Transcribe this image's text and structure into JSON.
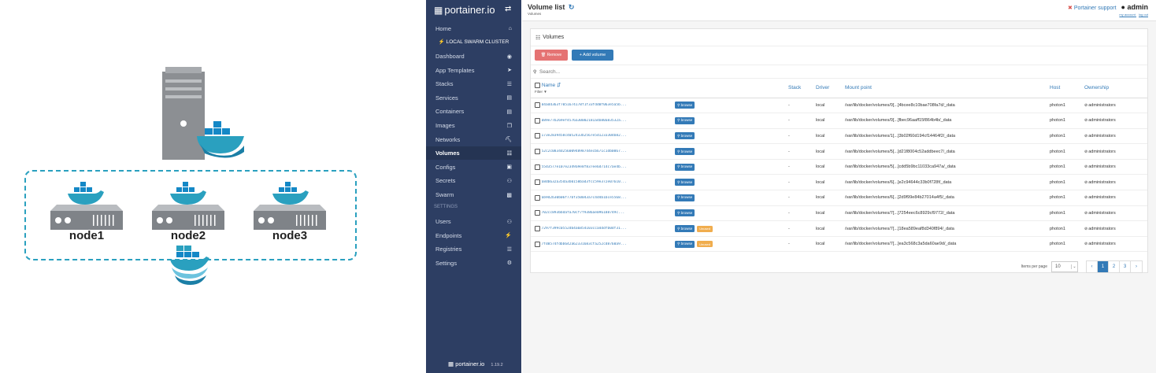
{
  "diagram": {
    "nodes": [
      "node1",
      "node2",
      "node3"
    ]
  },
  "sidebar": {
    "brand": "portainer.io",
    "cluster": "LOCAL SWARM CLUSTER",
    "home": "Home",
    "items": [
      {
        "label": "Dashboard",
        "icon": "tachometer-icon"
      },
      {
        "label": "App Templates",
        "icon": "rocket-icon"
      },
      {
        "label": "Stacks",
        "icon": "th-list-icon"
      },
      {
        "label": "Services",
        "icon": "list-alt-icon"
      },
      {
        "label": "Containers",
        "icon": "server-icon"
      },
      {
        "label": "Images",
        "icon": "clone-icon"
      },
      {
        "label": "Networks",
        "icon": "sitemap-icon"
      },
      {
        "label": "Volumes",
        "icon": "cubes-icon"
      },
      {
        "label": "Configs",
        "icon": "file-code-icon"
      },
      {
        "label": "Secrets",
        "icon": "user-secret-icon"
      },
      {
        "label": "Swarm",
        "icon": "object-group-icon"
      }
    ],
    "settings_header": "SETTINGS",
    "settings_items": [
      {
        "label": "Users",
        "icon": "users-icon"
      },
      {
        "label": "Endpoints",
        "icon": "plug-icon"
      },
      {
        "label": "Registries",
        "icon": "database-icon"
      },
      {
        "label": "Settings",
        "icon": "cogs-icon"
      }
    ],
    "footer_brand": "portainer.io",
    "footer_version": "1.19.2"
  },
  "header": {
    "title": "Volume list",
    "breadcrumb": "Volumes",
    "support": "Portainer support",
    "user": "admin",
    "my_account": "my account",
    "log_out": "log out"
  },
  "panel": {
    "title": "Volumes",
    "remove_label": "Remove",
    "add_label": "+ Add volume",
    "search_placeholder": "Search...",
    "columns": {
      "name": "Name",
      "filter": "Filter",
      "stack": "Stack",
      "driver": "Driver",
      "mount": "Mount point",
      "host": "Host",
      "ownership": "Ownership"
    },
    "browse_label": "browse",
    "unused_label": "Unused",
    "rows": [
      {
        "name": "04add363f7051674178f1f33fdd0f063e5a5b...",
        "stack": "-",
        "driver": "local",
        "mount": "/var/lib/docker/volumes/0[...]4bcee8c10bae708fa7d/_data",
        "host": "photon1",
        "owner": "administrators",
        "unused": false
      },
      {
        "name": "089e77b269ef4576a30002181a4b80a83532a...",
        "stack": "-",
        "driver": "local",
        "mount": "/var/lib/docker/volumes/0[...]fbec96aaff15f864b4b/_data",
        "host": "photon1",
        "owner": "administrators",
        "unused": false
      },
      {
        "name": "173e2839458c4052433b2567e5d1233304b82...",
        "stack": "-",
        "driver": "local",
        "mount": "/var/lib/docker/volumes/1[...]3b02f60d194cf14464f2/_data",
        "host": "photon1",
        "owner": "administrators",
        "unused": false
      },
      {
        "name": "52c2c0834d2560094898744ecb671c1db0067...",
        "stack": "-",
        "driver": "local",
        "mount": "/var/lib/docker/volumes/5[...]d21f8004c52addbeec7/_data",
        "host": "photon1",
        "owner": "administrators",
        "unused": false
      },
      {
        "name": "55d3577e107e2349a9e8f837ee6d714c7ae4b...",
        "stack": "-",
        "driver": "local",
        "mount": "/var/lib/docker/volumes/5[...]cdd5b9bc11033ca947a/_data",
        "host": "photon1",
        "owner": "administrators",
        "unused": false
      },
      {
        "name": "68db632a35da3b0158bad3fcc59e372e07610...",
        "stack": "-",
        "driver": "local",
        "mount": "/var/lib/docker/volumes/6[...]e2c94644c33b0f728f/_data",
        "host": "photon1",
        "owner": "administrators",
        "unused": false
      },
      {
        "name": "6b9d2b30b06f77bf350043a7c4d4b1bce5568...",
        "stack": "-",
        "driver": "local",
        "mount": "/var/lib/docker/volumes/6[...]2d9f99e84b27014a4f5/_data",
        "host": "photon1",
        "owner": "administrators",
        "unused": false
      },
      {
        "name": "702cc893bbdafa70cf7f9386ae096188749c...",
        "stack": "-",
        "driver": "local",
        "mount": "/var/lib/docker/volumes/7[...]7254eec6c8929cf9772/_data",
        "host": "photon1",
        "owner": "administrators",
        "unused": false
      },
      {
        "name": "7297f399c0552db4a6854103cca4ddfb0df31...",
        "stack": "-",
        "driver": "local",
        "mount": "/var/lib/docker/volumes/7[...]18ea589eaf8d340f894/_data",
        "host": "photon1",
        "owner": "administrators",
        "unused": true
      },
      {
        "name": "7fd8574fdbb642a62331683cfa252cd8760a9...",
        "stack": "-",
        "driver": "local",
        "mount": "/var/lib/docker/volumes/7[...]ea3c568c3a5da60ae9d/_data",
        "host": "photon1",
        "owner": "administrators",
        "unused": true
      }
    ],
    "items_per_page_label": "Items per page",
    "items_per_page": "10",
    "pages": [
      "‹",
      "1",
      "2",
      "3",
      "›"
    ],
    "current_page": "1"
  },
  "colors": {
    "sidebar_bg": "#2d3e63",
    "accent": "#337ab7",
    "danger": "#e57373",
    "warning": "#f0ad4e",
    "docker": "#2aa0bf"
  }
}
